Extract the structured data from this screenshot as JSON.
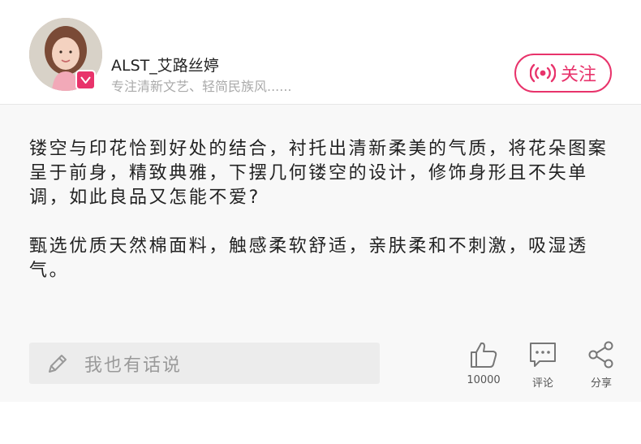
{
  "header": {
    "user_name": "ALST_艾路丝婷",
    "user_desc": "专注清新文艺、轻简民族风......",
    "follow_label": "关注"
  },
  "content": {
    "paragraph1": "镂空与印花恰到好处的结合，衬托出清新柔美的气质，将花朵图案呈于前身，精致典雅，下摆几何镂空的设计，修饰身形且不失单调，如此良品又怎能不爱?",
    "paragraph2": "甄选优质天然棉面料，触感柔软舒适，亲肤柔和不刺激，吸湿透气。"
  },
  "footer": {
    "comment_placeholder": "我也有话说",
    "like_count": "10000",
    "comment_label": "评论",
    "share_label": "分享"
  },
  "colors": {
    "accent": "#e8336b",
    "content_bg": "#f8f8f8",
    "input_bg": "#ececec"
  },
  "icons": [
    "pen-icon",
    "like-icon",
    "comment-icon",
    "share-icon",
    "broadcast-icon",
    "verified-badge-icon"
  ]
}
